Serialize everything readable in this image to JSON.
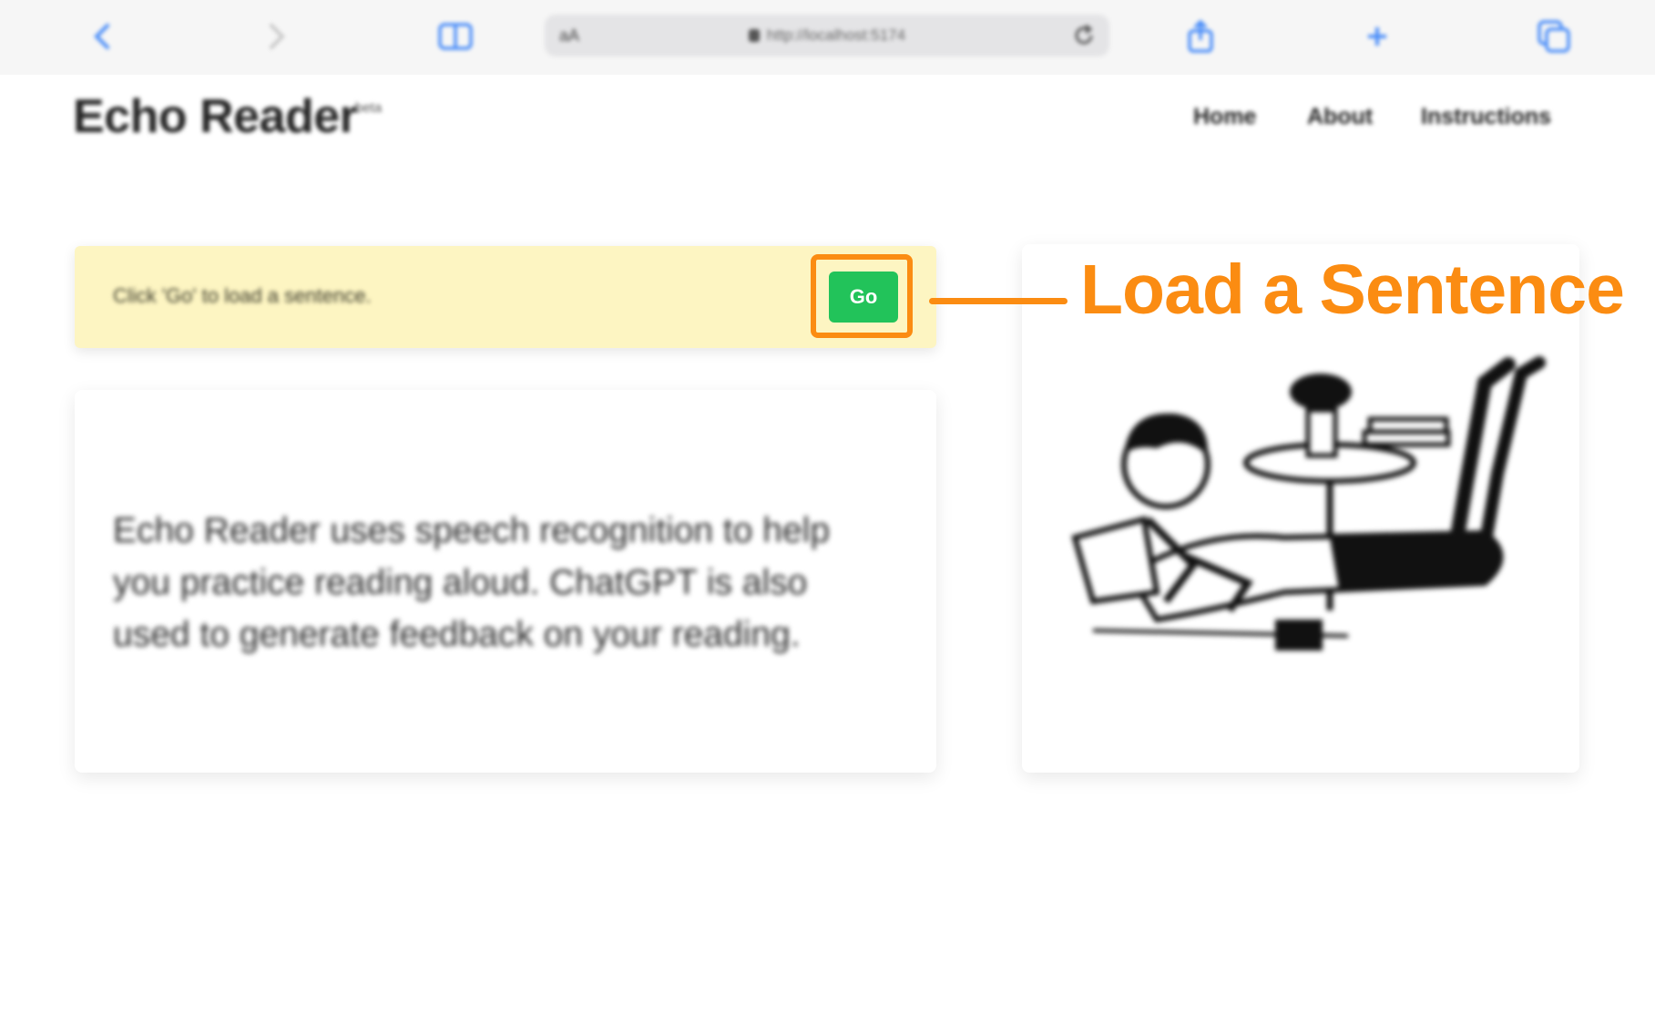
{
  "browser": {
    "address_aa": "aA",
    "url": "http://localhost:5174"
  },
  "site": {
    "brand": "Echo Reader",
    "badge": "beta",
    "nav": [
      "Home",
      "About",
      "Instructions"
    ]
  },
  "notice": {
    "text": "Click 'Go' to load a sentence.",
    "go_label": "Go"
  },
  "info": {
    "text": "Echo Reader uses speech recognition to help you practice reading aloud. ChatGPT is also used to generate feedback on your reading."
  },
  "annotation": {
    "label": "Load a Sentence"
  },
  "colors": {
    "accent_blue": "#4a8df8",
    "go_green": "#22c35a",
    "highlight_orange": "#fb8c12",
    "notice_bg": "#fdf5c2"
  },
  "icons": [
    "back-icon",
    "forward-icon",
    "sidebar-icon",
    "lock-icon",
    "reload-icon",
    "share-icon",
    "new-tab-icon",
    "tabs-icon",
    "woman-reading-illustration"
  ]
}
